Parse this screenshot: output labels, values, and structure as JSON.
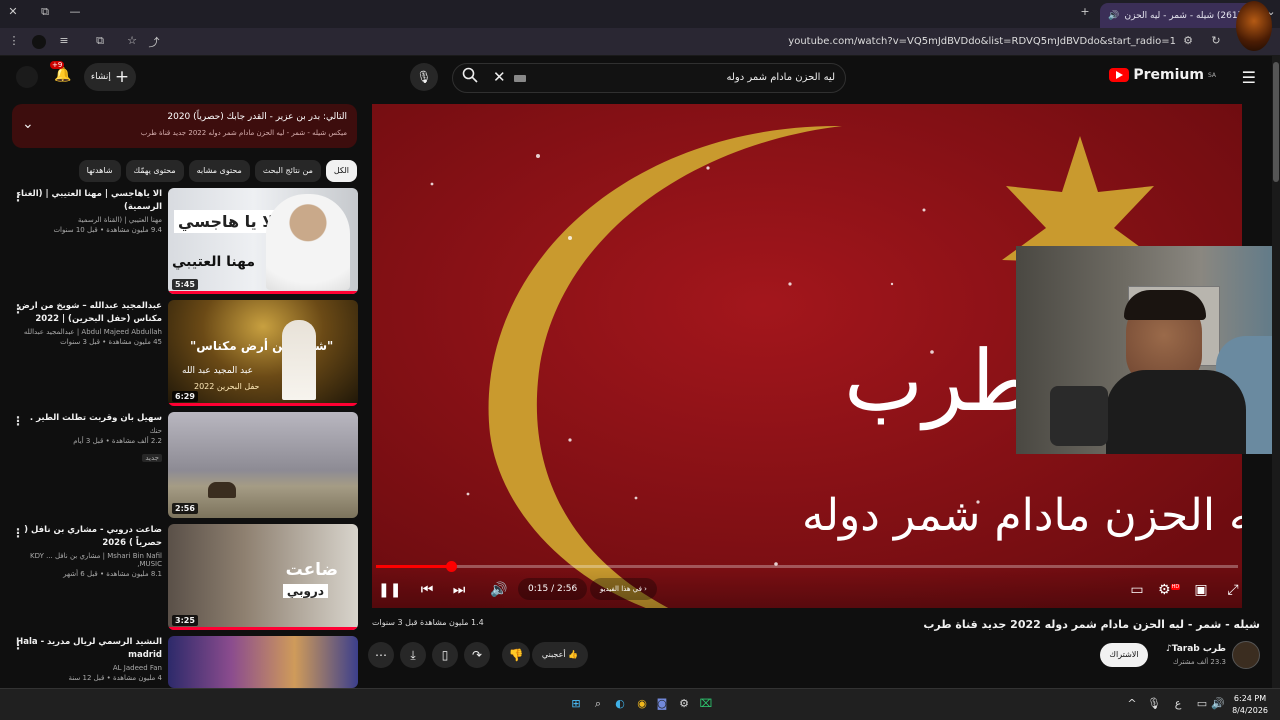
{
  "browser": {
    "tab_title": "(261) شيله - شمر - ليه الحزن ...",
    "url": "youtube.com/watch?v=VQ5mJdBVDdo&list=RDVQ5mJdBVDdo&start_radio=1"
  },
  "header": {
    "logo": "Premium",
    "logo_region": "SA",
    "search_query": "ليه الحزن مادام شمر دوله",
    "create_label": "إنشاء",
    "notification_count": "+9"
  },
  "playlist": {
    "next_label": "التالي: بدر بن عزير - القدر جابك (حصرياً) 2020",
    "sub_label": "ميكس شيله - شمر - ليه الحزن مادام شمر دوله 2022 جديد قناة طرب"
  },
  "chips": [
    "الكل",
    "من نتائج البحث",
    "محتوى مشابه",
    "محتوى يهمّك",
    "شاهدتها"
  ],
  "recommendations": [
    {
      "title": "الا ياهاجسي | مهنا العتيبي | (الغناء الرسمية)",
      "channel": "مهنا العتيبي | (القناة الرسمية",
      "meta": "9.4 مليون مشاهدة • قبل 10 سنوات",
      "duration": "5:45",
      "thumb_text": "الا يا هاجسي",
      "thumb_text2": "مهنا العتيبي"
    },
    {
      "title": "عبدالمجيد عبدالله – شويخ من ارض مكناس (حفل البحرين) | 2022",
      "channel": "Abdul Majeed Abdullah | عبدالمجيد عبدالله",
      "meta": "45 مليون مشاهدة • قبل 3 سنوات",
      "duration": "6:29",
      "thumb_text": "\"شويخ من أرض مكناس\"",
      "thumb_text2": "عبد المجيد عبد الله",
      "thumb_text3": "حفل البحرين 2022"
    },
    {
      "title": "سهيل بان وقربت تطلت الطير .",
      "channel": "حنك",
      "meta": "2.2 ألف مشاهدة • قبل 3 أيام",
      "badge": "جديد",
      "duration": "2:56"
    },
    {
      "title": "ضاعت دروبي - مشاري بن نافل ( حصرياً ) 2026",
      "channel": "Mshari Bin Nafil | مشاري بن نافل ... KDY MUSIC,",
      "meta": "8.1 مليون مشاهدة • قبل 6 أشهر",
      "duration": "3:25",
      "thumb_text": "ضاعت",
      "thumb_text2": "دروبي"
    },
    {
      "title": "النشيد الرسمي لريال مدريد - Hala madrid",
      "channel": "AL Jadeed Fan",
      "meta": "4 مليون مشاهدة • قبل 12 سنة",
      "duration": ""
    }
  ],
  "player": {
    "current_time": "0:15 / 2:56",
    "progress": 0.087,
    "chapter_label": "في هذا الفيديو",
    "overlay_brand": "طرب",
    "overlay_title": "ليه الحزن مادام شمر دوله",
    "hd_badge": "HD"
  },
  "video": {
    "title": "شيله - شمر - ليه الحزن مادام شمر دوله 2022 جديد قناة طرب",
    "views": "1.4 مليون مشاهدة  قبل 3 سنوات",
    "like_label": "أعجبني",
    "subscribe_label": "الاشتراك",
    "channel_name": "طرب Tarab♪",
    "channel_subs": "23.3 ألف مشترك"
  },
  "taskbar": {
    "time": "6:24 PM",
    "date": "8/4/2026",
    "lang": "ع"
  },
  "colors": {
    "accent": "#ff0000",
    "video_bg": "#8e1216",
    "moon": "#c99a2e"
  }
}
